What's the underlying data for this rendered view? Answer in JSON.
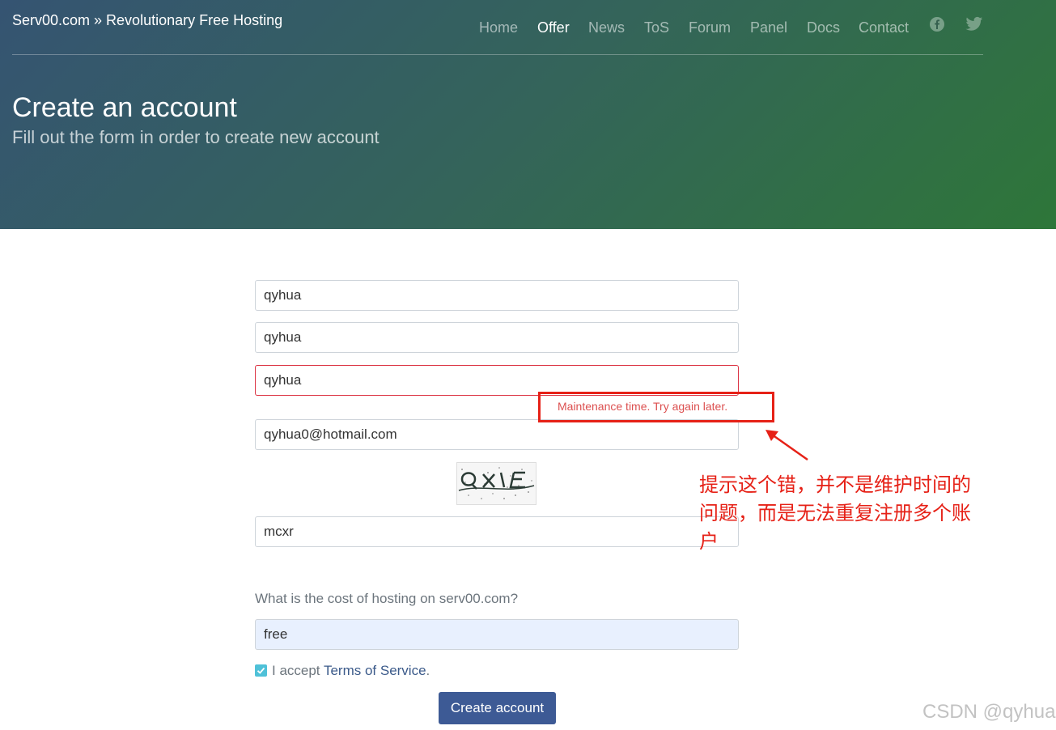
{
  "header": {
    "brand": "Serv00.com » Revolutionary Free Hosting",
    "nav": [
      {
        "label": "Home",
        "active": false
      },
      {
        "label": "Offer",
        "active": true
      },
      {
        "label": "News",
        "active": false
      },
      {
        "label": "ToS",
        "active": false
      },
      {
        "label": "Forum",
        "active": false
      },
      {
        "label": "Panel",
        "active": false
      },
      {
        "label": "Docs",
        "active": false
      },
      {
        "label": "Contact",
        "active": false
      }
    ],
    "social_icons": [
      "facebook-icon",
      "twitter-icon"
    ]
  },
  "hero": {
    "title": "Create an account",
    "subtitle": "Fill out the form in order to create new account"
  },
  "form": {
    "first_name": "qyhua",
    "last_name": "qyhua",
    "username": "qyhua",
    "username_error": "Maintenance time. Try again later.",
    "email": "qyhua0@hotmail.com",
    "captcha_text": "mcxr",
    "question": "What is the cost of hosting on serv00.com?",
    "answer": "free",
    "tos_prefix": "I accept ",
    "tos_link": "Terms of Service",
    "tos_suffix": ".",
    "tos_checked": true,
    "submit_label": "Create account"
  },
  "annotation": {
    "text": "提示这个错，并不是维护时间的问题，而是无法重复注册多个账户",
    "color": "#e62117"
  },
  "watermark": "CSDN @qyhua",
  "colors": {
    "hero_start": "#355472",
    "hero_end": "#2e7639",
    "button": "#3d5a95",
    "error": "#dc3545",
    "checkbox": "#4fc1d8"
  }
}
